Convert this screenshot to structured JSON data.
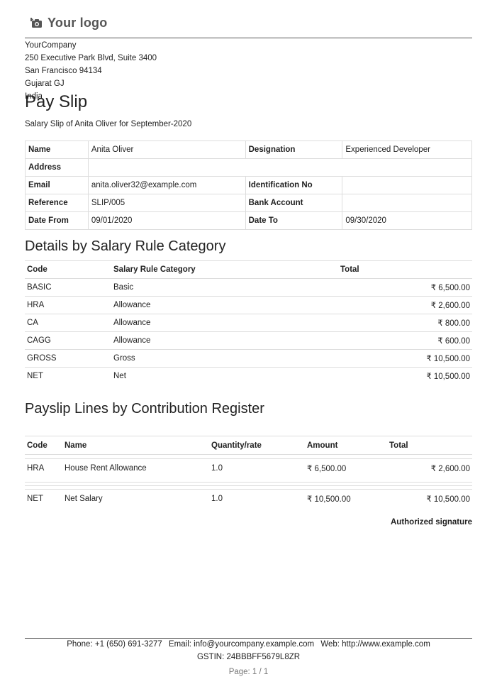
{
  "header": {
    "logo_text": "Your logo",
    "logo_icon": "camera-icon"
  },
  "company": {
    "name": "YourCompany",
    "street": "250 Executive Park Blvd, Suite 3400",
    "city": "San Francisco 94134",
    "state": "Gujarat GJ",
    "country": "India"
  },
  "document": {
    "title": "Pay Slip",
    "subtitle": "Salary Slip of Anita Oliver for September-2020"
  },
  "employee_info": {
    "name_label": "Name",
    "name_value": "Anita Oliver",
    "designation_label": "Designation",
    "designation_value": "Experienced Developer",
    "address_label": "Address",
    "address_value": "",
    "email_label": "Email",
    "email_value": "anita.oliver32@example.com",
    "id_label": "Identification No",
    "id_value": "",
    "reference_label": "Reference",
    "reference_value": "SLIP/005",
    "bank_label": "Bank Account",
    "bank_value": "",
    "date_from_label": "Date From",
    "date_from_value": "09/01/2020",
    "date_to_label": "Date To",
    "date_to_value": "09/30/2020"
  },
  "salary_category": {
    "heading": "Details by Salary Rule Category",
    "columns": [
      "Code",
      "Salary Rule Category",
      "Total"
    ],
    "rows": [
      {
        "code": "BASIC",
        "category": "Basic",
        "total": "₹ 6,500.00"
      },
      {
        "code": "HRA",
        "category": "Allowance",
        "total": "₹ 2,600.00"
      },
      {
        "code": "CA",
        "category": "Allowance",
        "total": "₹ 800.00"
      },
      {
        "code": "CAGG",
        "category": "Allowance",
        "total": "₹ 600.00"
      },
      {
        "code": "GROSS",
        "category": "Gross",
        "total": "₹ 10,500.00"
      },
      {
        "code": "NET",
        "category": "Net",
        "total": "₹ 10,500.00"
      }
    ]
  },
  "contribution": {
    "heading": "Payslip Lines by Contribution Register",
    "columns": [
      "Code",
      "Name",
      "Quantity/rate",
      "Amount",
      "Total"
    ],
    "rows": [
      {
        "code": "HRA",
        "name": "House Rent Allowance",
        "qty": "1.0",
        "amount": "₹ 6,500.00",
        "total": "₹ 2,600.00"
      },
      {
        "code": "NET",
        "name": "Net Salary",
        "qty": "1.0",
        "amount": "₹ 10,500.00",
        "total": "₹ 10,500.00"
      }
    ]
  },
  "signature": "Authorized signature",
  "footer": {
    "phone": "Phone: +1 (650) 691-3277",
    "email": "Email: info@yourcompany.example.com",
    "web": "Web: http://www.example.com",
    "gstin": "GSTIN: 24BBBFF5679L8ZR",
    "page": "Page: 1 / 1"
  }
}
